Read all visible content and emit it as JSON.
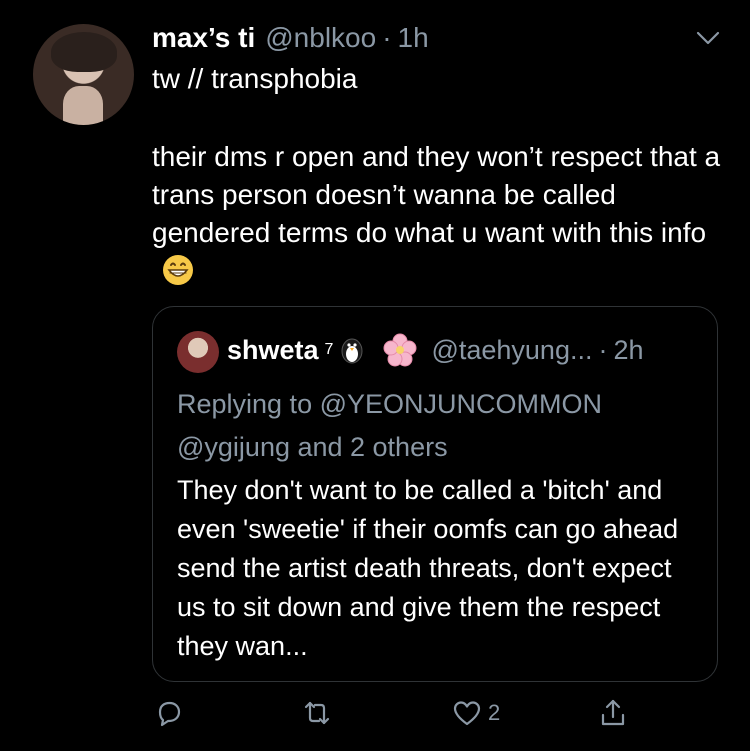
{
  "tweet": {
    "name": "max’s ti",
    "handle": "@nblkoo",
    "separator": "·",
    "time": "1h",
    "tw_line": "tw // transphobia",
    "text": "their dms r open and they won’t respect that a trans person doesn’t wanna be called gendered terms do what u want with this info",
    "emoji_icon": "grinning-face-emoji"
  },
  "quote": {
    "name": "shweta",
    "name_suffix": "7",
    "handle": "@taehyung...",
    "separator": "·",
    "time": "2h",
    "replying_to": "Replying to @YEONJUNCOMMON @ygijung and 2 others",
    "text": "They don't want to be called a 'bitch' and even 'sweetie' if their oomfs can go ahead send the artist death threats, don't expect us to sit down and give them the respect they wan..."
  },
  "actions": {
    "like_count": "2"
  },
  "colors": {
    "background": "#000000",
    "text": "#ffffff",
    "muted": "#8b98a5",
    "border": "#2f3336"
  }
}
